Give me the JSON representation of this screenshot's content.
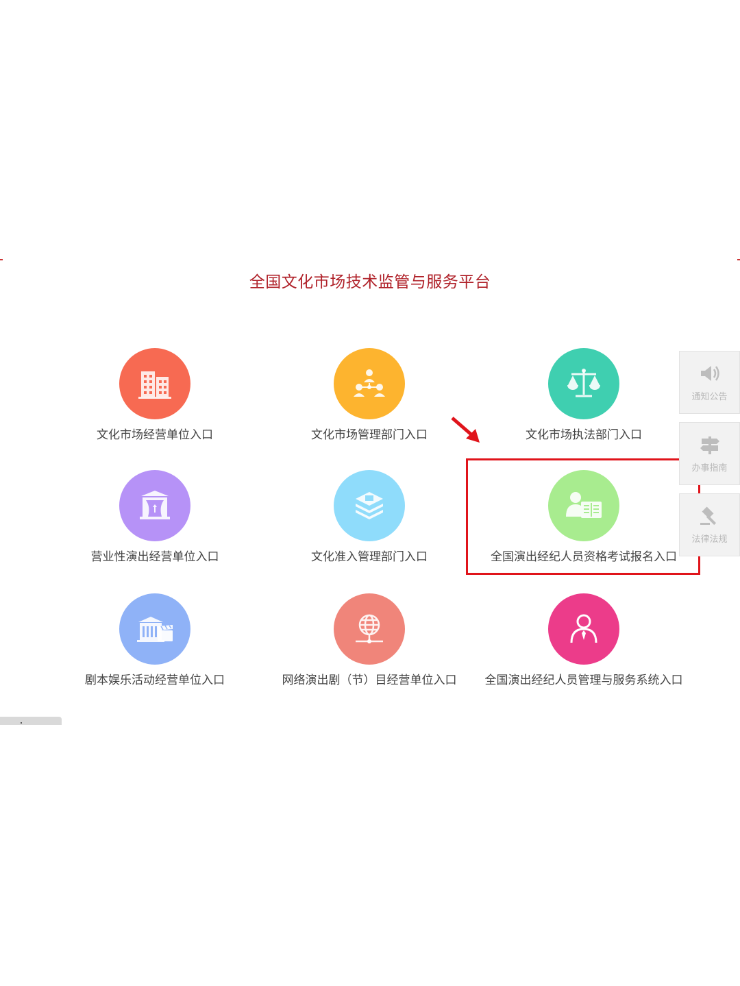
{
  "page": {
    "title": "全国文化市场技术监管与服务平台"
  },
  "entries": [
    {
      "label": "文化市场经营单位入口",
      "icon": "building-icon",
      "color": "#f76a52"
    },
    {
      "label": "文化市场管理部门入口",
      "icon": "org-chart-icon",
      "color": "#fdb42f"
    },
    {
      "label": "文化市场执法部门入口",
      "icon": "scales-icon",
      "color": "#3fcfb0"
    },
    {
      "label": "营业性演出经营单位入口",
      "icon": "theater-stage-icon",
      "color": "#b692f7"
    },
    {
      "label": "文化准入管理部门入口",
      "icon": "layers-icon",
      "color": "#8fdcfb"
    },
    {
      "label": "全国演出经纪人员资格考试报名入口",
      "icon": "person-book-icon",
      "color": "#a8ec8f"
    },
    {
      "label": "剧本娱乐活动经营单位入口",
      "icon": "building-clapper-icon",
      "color": "#8fb2f7"
    },
    {
      "label": "网络演出剧（节）目经营单位入口",
      "icon": "globe-network-icon",
      "color": "#f0857a"
    },
    {
      "label": "全国演出经纪人员管理与服务系统入口",
      "icon": "agent-person-icon",
      "color": "#ec3c8a"
    }
  ],
  "side_tabs": [
    {
      "label": "通知公告",
      "icon": "speaker-icon"
    },
    {
      "label": "办事指南",
      "icon": "signpost-icon"
    },
    {
      "label": "法律法规",
      "icon": "gavel-icon"
    }
  ],
  "annotation": {
    "highlight_color": "#e0141b"
  }
}
